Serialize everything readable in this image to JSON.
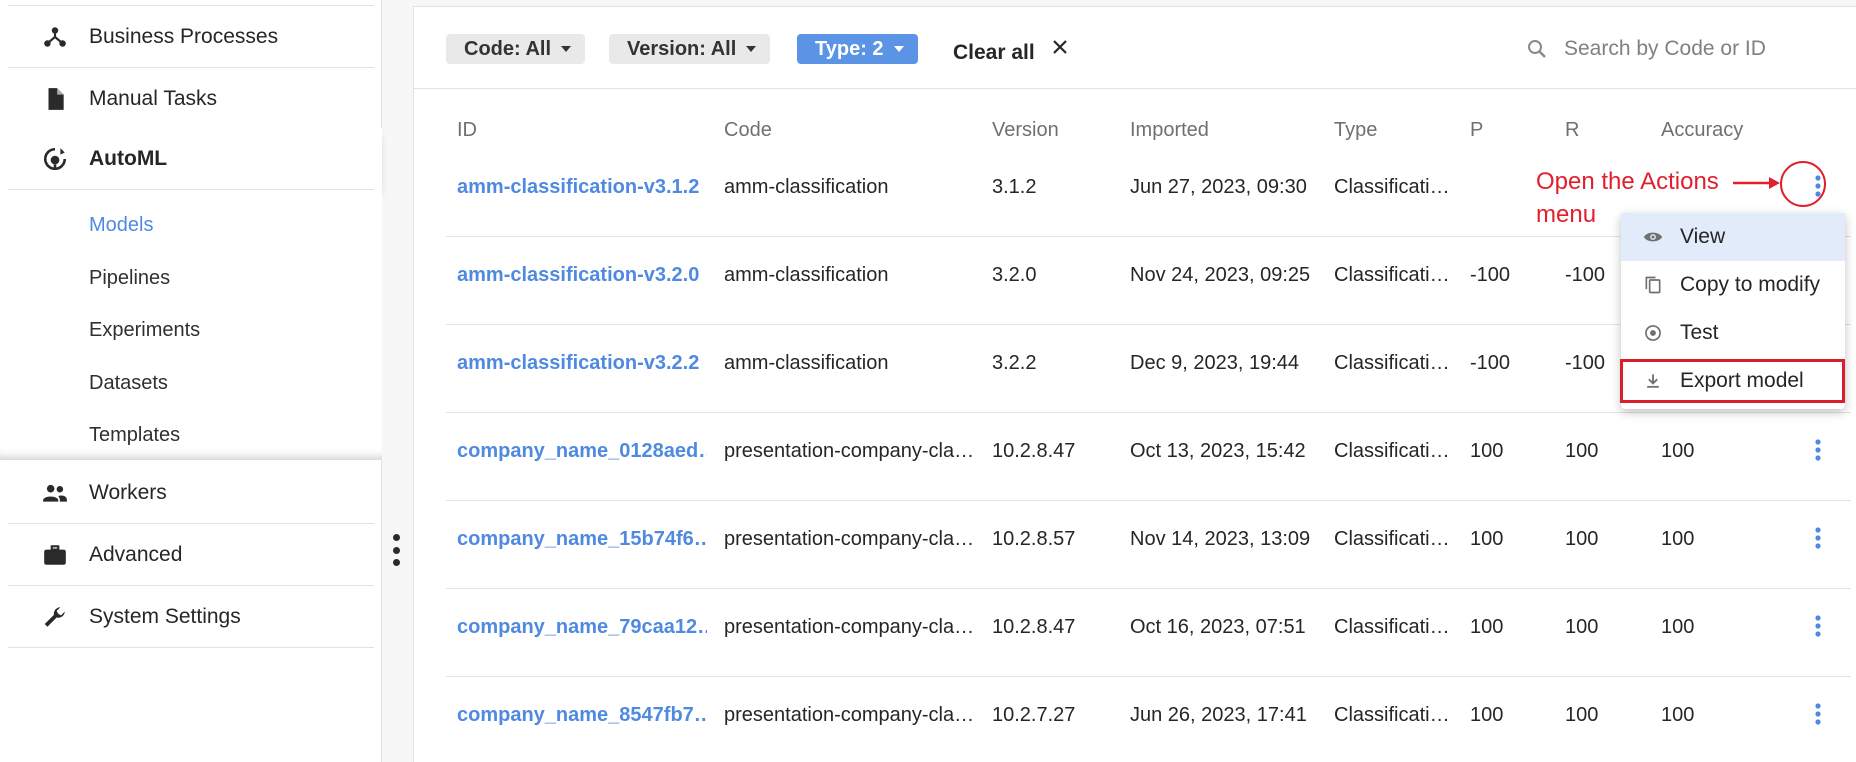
{
  "sidebar": {
    "items": [
      {
        "label": "Business Processes",
        "icon": "business-processes-icon"
      },
      {
        "label": "Manual Tasks",
        "icon": "document-icon"
      },
      {
        "label": "AutoML",
        "icon": "automl-icon"
      },
      {
        "label": "Workers",
        "icon": "people-icon"
      },
      {
        "label": "Advanced",
        "icon": "briefcase-icon"
      },
      {
        "label": "System Settings",
        "icon": "wrench-icon"
      }
    ],
    "automl_sub": [
      "Models",
      "Pipelines",
      "Experiments",
      "Datasets",
      "Templates"
    ],
    "active_item": "AutoML",
    "active_sub": "Models"
  },
  "filters": {
    "code": "Code: All",
    "version": "Version: All",
    "type": "Type: 2",
    "clear_all": "Clear all"
  },
  "search": {
    "placeholder": "Search by Code or ID",
    "value": ""
  },
  "table": {
    "headers": [
      "ID",
      "Code",
      "Version",
      "Imported",
      "Type",
      "P",
      "R",
      "Accuracy"
    ],
    "rows": [
      {
        "id": "amm-classification-v3.1.2",
        "code": "amm-classification",
        "version": "3.1.2",
        "imported": "Jun 27, 2023, 09:30",
        "type": "Classificati…",
        "p": "",
        "r": "",
        "accuracy": ""
      },
      {
        "id": "amm-classification-v3.2.0",
        "code": "amm-classification",
        "version": "3.2.0",
        "imported": "Nov 24, 2023, 09:25",
        "type": "Classificati…",
        "p": "-100",
        "r": "-100",
        "accuracy": ""
      },
      {
        "id": "amm-classification-v3.2.2",
        "code": "amm-classification",
        "version": "3.2.2",
        "imported": "Dec 9, 2023, 19:44",
        "type": "Classificati…",
        "p": "-100",
        "r": "-100",
        "accuracy": ""
      },
      {
        "id": "company_name_0128aed…",
        "code": "presentation-company-cla…",
        "version": "10.2.8.47",
        "imported": "Oct 13, 2023, 15:42",
        "type": "Classificati…",
        "p": "100",
        "r": "100",
        "accuracy": "100"
      },
      {
        "id": "company_name_15b74f6…",
        "code": "presentation-company-cla…",
        "version": "10.2.8.57",
        "imported": "Nov 14, 2023, 13:09",
        "type": "Classificati…",
        "p": "100",
        "r": "100",
        "accuracy": "100"
      },
      {
        "id": "company_name_79caa12…",
        "code": "presentation-company-cla…",
        "version": "10.2.8.47",
        "imported": "Oct 16, 2023, 07:51",
        "type": "Classificati…",
        "p": "100",
        "r": "100",
        "accuracy": "100"
      },
      {
        "id": "company_name_8547fb7…",
        "code": "presentation-company-cla…",
        "version": "10.2.7.27",
        "imported": "Jun 26, 2023, 17:41",
        "type": "Classificati…",
        "p": "100",
        "r": "100",
        "accuracy": "100"
      }
    ]
  },
  "actions_menu": {
    "items": [
      {
        "label": "View",
        "icon": "eye-icon"
      },
      {
        "label": "Copy to modify",
        "icon": "copy-icon"
      },
      {
        "label": "Test",
        "icon": "radio-target-icon"
      },
      {
        "label": "Export model",
        "icon": "download-icon"
      }
    ],
    "hovered": "View"
  },
  "annotation": {
    "text_line1": "Open the Actions",
    "text_line2": "menu",
    "color": "#e0202c"
  },
  "colors": {
    "accent": "#4f8ae0",
    "chip_primary": "#5b94e5",
    "menu_highlight": "#e2ebfa",
    "annotation": "#e0202c"
  }
}
